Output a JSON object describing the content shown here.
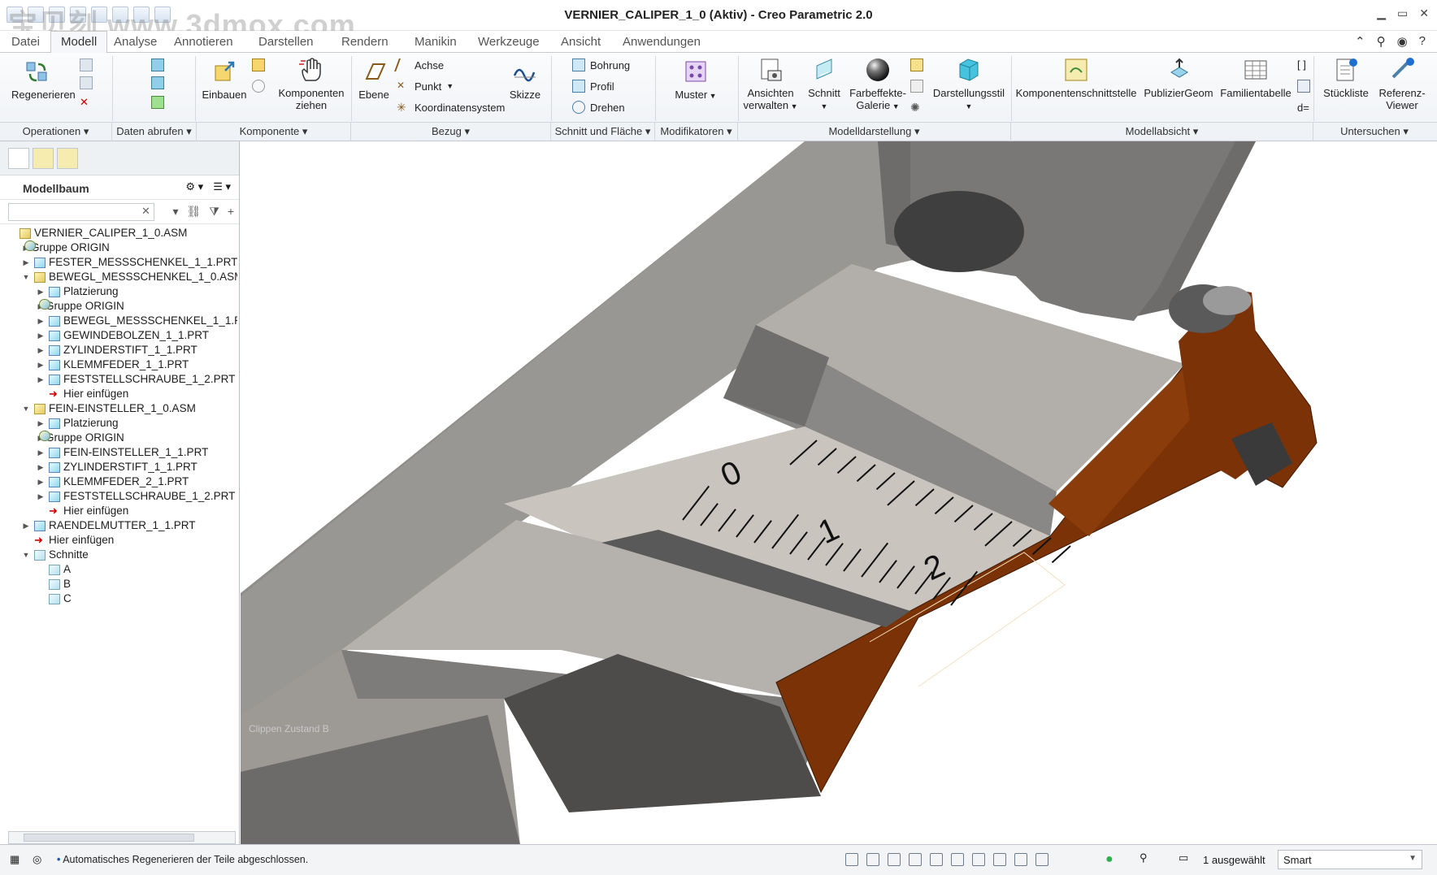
{
  "window": {
    "title": "VERNIER_CALIPER_1_0 (Aktiv) - Creo Parametric 2.0",
    "watermark": "宝贝刻 www.3dmox.com"
  },
  "tabs": {
    "items": [
      "Datei",
      "Modell",
      "Analyse",
      "Annotieren",
      "Darstellen",
      "Rendern",
      "Manikin",
      "Werkzeuge",
      "Ansicht",
      "Anwendungen"
    ]
  },
  "ribbon": {
    "regenerate": "Regenerieren",
    "assemble": "Einbauen",
    "drag_components": "Komponenten ziehen",
    "plane": "Ebene",
    "axis": "Achse",
    "point": "Punkt",
    "csys": "Koordinatensystem",
    "sketch": "Skizze",
    "hole": "Bohrung",
    "profile": "Profil",
    "revolve": "Drehen",
    "pattern": "Muster",
    "manage_views": "Ansichten verwalten",
    "section": "Schnitt",
    "appearance_gallery": "Farbeffekte-Galerie",
    "display_style": "Darstellungsstil",
    "component_interface": "Komponentenschnittstelle",
    "publish_geom": "PublizierGeom",
    "family_table": "Familientabelle",
    "bom": "Stückliste",
    "reference_viewer": "Referenz-Viewer"
  },
  "groups": {
    "operations": "Operationen",
    "get_data": "Daten abrufen",
    "component": "Komponente",
    "datum": "Bezug",
    "cut_surface": "Schnitt und Fläche",
    "modifiers": "Modifikatoren",
    "model_display": "Modelldarstellung",
    "model_intent": "Modellabsicht",
    "investigate": "Untersuchen"
  },
  "model_tree": {
    "header": "Modellbaum",
    "search_placeholder": "",
    "items": [
      {
        "label": "VERNIER_CALIPER_1_0.ASM",
        "type": "asm",
        "level": 0,
        "toggle": ""
      },
      {
        "label": "Gruppe ORIGIN",
        "type": "grp",
        "level": 1,
        "toggle": "▶"
      },
      {
        "label": "FESTER_MESSSCHENKEL_1_1.PRT",
        "type": "prt",
        "level": 1,
        "toggle": "▶"
      },
      {
        "label": "BEWEGL_MESSSCHENKEL_1_0.ASM",
        "type": "asm",
        "level": 1,
        "toggle": "▼"
      },
      {
        "label": "Platzierung",
        "type": "prt",
        "level": 2,
        "toggle": "▶"
      },
      {
        "label": "Gruppe ORIGIN",
        "type": "grp",
        "level": 2,
        "toggle": "▶"
      },
      {
        "label": "BEWEGL_MESSSCHENKEL_1_1.PRT",
        "type": "prt",
        "level": 2,
        "toggle": "▶"
      },
      {
        "label": "GEWINDEBOLZEN_1_1.PRT",
        "type": "prt",
        "level": 2,
        "toggle": "▶"
      },
      {
        "label": "ZYLINDERSTIFT_1_1.PRT",
        "type": "prt",
        "level": 2,
        "toggle": "▶"
      },
      {
        "label": "KLEMMFEDER_1_1.PRT",
        "type": "prt",
        "level": 2,
        "toggle": "▶"
      },
      {
        "label": "FESTSTELLSCHRAUBE_1_2.PRT",
        "type": "prt",
        "level": 2,
        "toggle": "▶"
      },
      {
        "label": "Hier einfügen",
        "type": "ins",
        "level": 2,
        "toggle": ""
      },
      {
        "label": "FEIN-EINSTELLER_1_0.ASM",
        "type": "asm",
        "level": 1,
        "toggle": "▼"
      },
      {
        "label": "Platzierung",
        "type": "prt",
        "level": 2,
        "toggle": "▶"
      },
      {
        "label": "Gruppe ORIGIN",
        "type": "grp",
        "level": 2,
        "toggle": "▶"
      },
      {
        "label": "FEIN-EINSTELLER_1_1.PRT",
        "type": "prt",
        "level": 2,
        "toggle": "▶"
      },
      {
        "label": "ZYLINDERSTIFT_1_1.PRT",
        "type": "prt",
        "level": 2,
        "toggle": "▶"
      },
      {
        "label": "KLEMMFEDER_2_1.PRT",
        "type": "prt",
        "level": 2,
        "toggle": "▶"
      },
      {
        "label": "FESTSTELLSCHRAUBE_1_2.PRT",
        "type": "prt",
        "level": 2,
        "toggle": "▶"
      },
      {
        "label": "Hier einfügen",
        "type": "ins",
        "level": 2,
        "toggle": ""
      },
      {
        "label": "RAENDELMUTTER_1_1.PRT",
        "type": "prt",
        "level": 1,
        "toggle": "▶"
      },
      {
        "label": "Hier einfügen",
        "type": "ins",
        "level": 1,
        "toggle": ""
      },
      {
        "label": "Schnitte",
        "type": "sec",
        "level": 1,
        "toggle": "▼"
      },
      {
        "label": "A",
        "type": "sec",
        "level": 2,
        "toggle": ""
      },
      {
        "label": "B",
        "type": "sec",
        "level": 2,
        "toggle": ""
      },
      {
        "label": "C",
        "type": "sec",
        "level": 2,
        "toggle": ""
      }
    ]
  },
  "viewport": {
    "clip_label": "Clippen Zustand B",
    "scale_labels": [
      "0",
      "1",
      "2"
    ]
  },
  "status": {
    "message": "Automatisches Regenerieren der Teile abgeschlossen.",
    "selected": "1 ausgewählt",
    "filter": "Smart"
  }
}
